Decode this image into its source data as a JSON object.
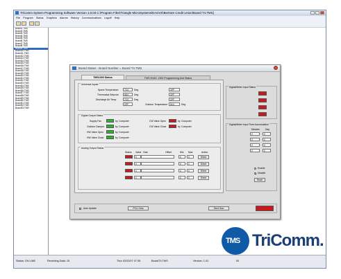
{
  "window": {
    "title": "TriComm System Programming Software  Version 1.0.03   C:\\Program Files\\Triangle MicroSystems\\EAGVS\\Bertram Credit Union\\Board T4.TMS]",
    "menu": [
      "File",
      "Program",
      "Status",
      "Graphics",
      "Alarms",
      "History",
      "Communications",
      "Logoff",
      "Help"
    ]
  },
  "sidebar": {
    "items": [
      "Board1.TMS",
      "Board2.TMS",
      "Board3.TMS",
      "Board4.TMS",
      "Board5.TMS",
      "Board6.TMS",
      "Board7.TMS",
      "Board8.TMS",
      "Board9.TMS",
      "Board10.TMS",
      "Board11.TMS",
      "Board12.TMS",
      "Board13.TMS",
      "Board14.TMS",
      "Board15.TMS",
      "Board16.TMS",
      "Board17.TMS",
      "Board18.TMS",
      "Board19.TMS",
      "Board20.TMS",
      "Board21.TMS",
      "Board22.TMS",
      "Board23.TMS",
      "Board24.TMS",
      "Board25.TMS",
      "Board26.TMS",
      "Board27.TMS",
      "Board28.TMS",
      "Board29.TMS",
      "Board30.TMS",
      "Board31.TMS",
      "Board32.TMS",
      "Board33.TMS"
    ],
    "selected_index": 8
  },
  "dialog": {
    "title": "Board Status - Board Number = Board T4.TMS",
    "tabs": [
      "TMS1300 Status",
      "TMS-HVAC 1300 Programming And Status"
    ],
    "universal_inputs": {
      "title": "Universal Inputs",
      "rows": [
        {
          "label": "Space Temperature",
          "value": "70.0",
          "unit": "Deg",
          "status": "OFF"
        },
        {
          "label": "Thermostat Setpoint",
          "value": "68.0",
          "unit": "Deg",
          "status": "OFF"
        },
        {
          "label": "Discharge Air Temp",
          "value": "70.0",
          "unit": "Deg",
          "status": "OFF"
        },
        {
          "label": "",
          "value": "OFF",
          "unit": "",
          "status": "54.0"
        }
      ],
      "outdoor_label": "Outdoor Temperature",
      "outdoor_unit": "Deg"
    },
    "digital_outputs": {
      "title": "Digital Output Status",
      "left": [
        {
          "label": "Supply Fan",
          "state": "ON",
          "color": "#2cb52c",
          "by": "by",
          "source": "Computer"
        },
        {
          "label": "Outdoor Damper",
          "state": "ON",
          "color": "#2cb52c",
          "by": "by",
          "source": "Computer"
        },
        {
          "label": "HW Valve Open",
          "state": "ON",
          "color": "#2cb52c",
          "by": "by",
          "source": "Computer"
        },
        {
          "label": "HW Valve Close",
          "state": "ON",
          "color": "#2cb52c",
          "by": "by",
          "source": "Computer"
        }
      ],
      "right": [
        {
          "label": "CW Valve Open",
          "state": "OFF",
          "color": "#c8191e",
          "by": "by",
          "source": "Computer"
        },
        {
          "label": "CW Valve Close",
          "state": "OFF",
          "color": "#c8191e",
          "by": "by",
          "source": "Computer"
        }
      ]
    },
    "analog_outputs": {
      "title": "Analog Output Status",
      "headers": [
        "Status",
        "Value",
        "Gain",
        "Offset",
        "Min",
        "Max",
        "Action"
      ],
      "rows": [
        {
          "value": "0",
          "min": "0",
          "max": "0",
          "action": "Direct"
        },
        {
          "value": "0",
          "min": "0",
          "max": "0",
          "action": "Direct"
        },
        {
          "value": "0",
          "min": "0",
          "max": "0",
          "action": "Direct"
        },
        {
          "value": "0",
          "min": "0",
          "max": "0",
          "action": "Direct"
        }
      ]
    },
    "digital_inputs": {
      "title": "Digital/Meter Input Status"
    },
    "accumulation": {
      "title": "Digital/Meter Input Time Accumulation",
      "headers": [
        "Minutes",
        "Day"
      ],
      "rows": [
        [
          "0",
          "0"
        ],
        [
          "0",
          "0"
        ],
        [
          "0",
          "0"
        ],
        [
          "0",
          "0"
        ]
      ]
    },
    "right_controls": {
      "enable_label": "Enable",
      "disable_label": "Disable",
      "reset_label": "Reset"
    },
    "footer": {
      "auto_update_label": "Auto Update",
      "poll_button": "POLL Now",
      "send_button": "Send Now"
    }
  },
  "statusbar": {
    "status": "Status: ON LINE",
    "receiving": "Receiving Data: 15",
    "datetime": "Thur 02/22/07 07:35",
    "file": "BoardT4.TMS",
    "version_label": "Version: 1.01",
    "version_value": "00"
  },
  "logo": {
    "mark": "TMS",
    "word": "TriComm."
  }
}
